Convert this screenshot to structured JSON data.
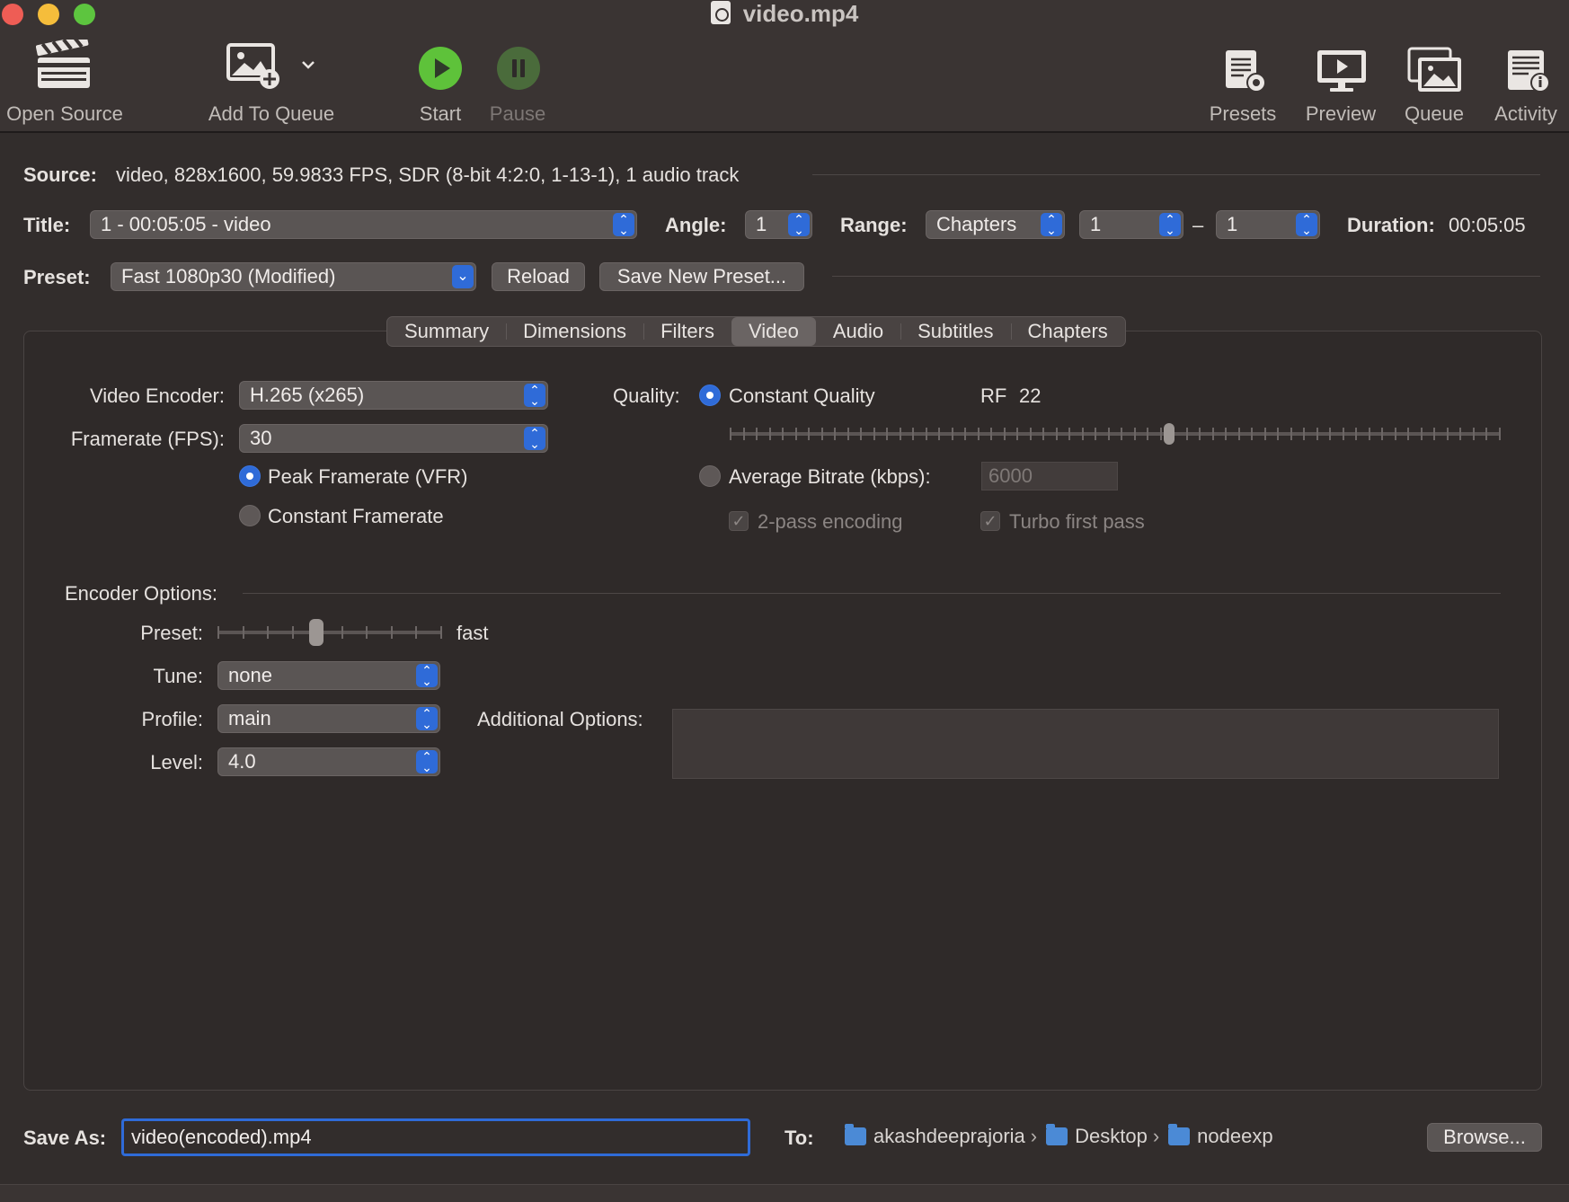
{
  "window": {
    "title": "video.mp4",
    "traffic_lights": {
      "close": "#ee5d55",
      "minimize": "#f5bd3b",
      "zoom": "#5dc53f"
    }
  },
  "toolbar": {
    "open_source": "Open Source",
    "add_to_queue": "Add To Queue",
    "start": "Start",
    "pause": "Pause",
    "presets": "Presets",
    "preview": "Preview",
    "queue": "Queue",
    "activity": "Activity"
  },
  "source": {
    "label": "Source:",
    "value": "video, 828x1600, 59.9833 FPS, SDR (8-bit 4:2:0, 1-13-1), 1 audio track"
  },
  "title_row": {
    "title_label": "Title:",
    "title_value": "1 - 00:05:05 - video",
    "angle_label": "Angle:",
    "angle_value": "1",
    "range_label": "Range:",
    "range_value": "Chapters",
    "range_start": "1",
    "range_dash": "–",
    "range_end": "1",
    "duration_label": "Duration:",
    "duration_value": "00:05:05"
  },
  "preset_row": {
    "label": "Preset:",
    "value": "Fast 1080p30 (Modified)",
    "reload": "Reload",
    "save_new": "Save New Preset..."
  },
  "tabs": [
    "Summary",
    "Dimensions",
    "Filters",
    "Video",
    "Audio",
    "Subtitles",
    "Chapters"
  ],
  "selected_tab": "Video",
  "video": {
    "encoder_label": "Video Encoder:",
    "encoder_value": "H.265 (x265)",
    "framerate_label": "Framerate (FPS):",
    "framerate_value": "30",
    "peak_vfr": "Peak Framerate (VFR)",
    "constant_fr": "Constant Framerate",
    "framerate_mode": "Peak Framerate (VFR)",
    "quality_label": "Quality:",
    "constant_quality": "Constant Quality",
    "rf_label": "RF",
    "rf_value": "22",
    "rf_slider_fraction": 0.57,
    "avg_bitrate": "Average Bitrate (kbps):",
    "bitrate_value": "6000",
    "two_pass": "2-pass encoding",
    "turbo": "Turbo first pass",
    "quality_mode": "Constant Quality"
  },
  "encoder_options": {
    "heading": "Encoder Options:",
    "preset_label": "Preset:",
    "preset_value": "fast",
    "preset_slider_fraction": 0.44,
    "tune_label": "Tune:",
    "tune_value": "none",
    "profile_label": "Profile:",
    "profile_value": "main",
    "level_label": "Level:",
    "level_value": "4.0",
    "additional_label": "Additional Options:",
    "additional_value": ""
  },
  "save": {
    "label": "Save As:",
    "filename": "video(encoded).mp4",
    "to_label": "To:",
    "path": [
      "akashdeeprajoria",
      "Desktop",
      "nodeexp"
    ],
    "browse": "Browse..."
  },
  "colors": {
    "accent": "#2f6bd8",
    "background": "#322d2c",
    "start_green": "#5ec23a",
    "pause_green": "#4a6b3b"
  }
}
